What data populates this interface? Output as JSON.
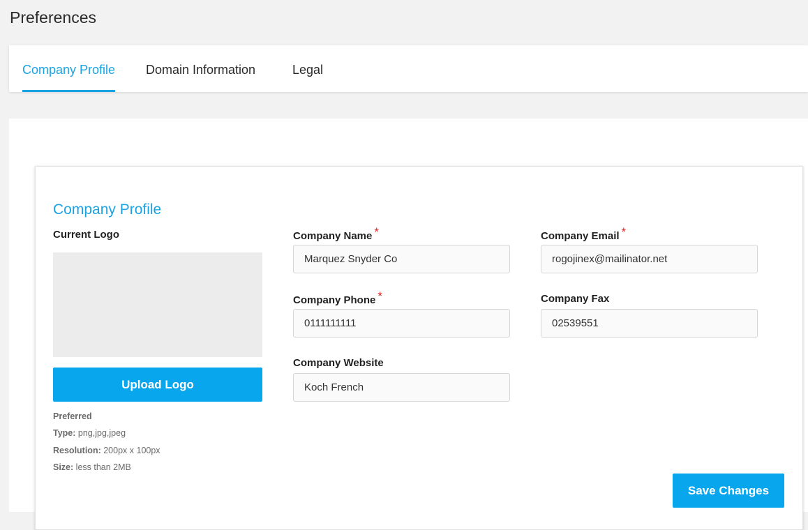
{
  "page": {
    "title": "Preferences"
  },
  "tabs": [
    {
      "label": "Company Profile",
      "active": true
    },
    {
      "label": "Domain Information",
      "active": false
    },
    {
      "label": "Legal",
      "active": false
    }
  ],
  "profile": {
    "section_title": "Company Profile",
    "current_logo_label": "Current Logo",
    "upload_button": "Upload Logo",
    "preferred": {
      "heading": "Preferred",
      "type_label": "Type:",
      "type_value": "png,jpg,jpeg",
      "resolution_label": "Resolution:",
      "resolution_value": "200px x 100px",
      "size_label": "Size:",
      "size_value": "less than 2MB"
    },
    "fields": {
      "company_name": {
        "label": "Company Name",
        "required_mark": "*",
        "value": "Marquez Snyder Co"
      },
      "company_email": {
        "label": "Company Email",
        "required_mark": "*",
        "value": "rogojinex@mailinator.net"
      },
      "company_phone": {
        "label": "Company Phone",
        "required_mark": "*",
        "value": "0111111111"
      },
      "company_fax": {
        "label": "Company Fax",
        "value": "02539551"
      },
      "company_website": {
        "label": "Company Website",
        "value": "Koch French"
      }
    },
    "save_button": "Save Changes"
  },
  "colors": {
    "accent": "#1aa3e3",
    "button": "#08a6ec",
    "required": "#e0201f",
    "background": "#f2f2f2"
  }
}
